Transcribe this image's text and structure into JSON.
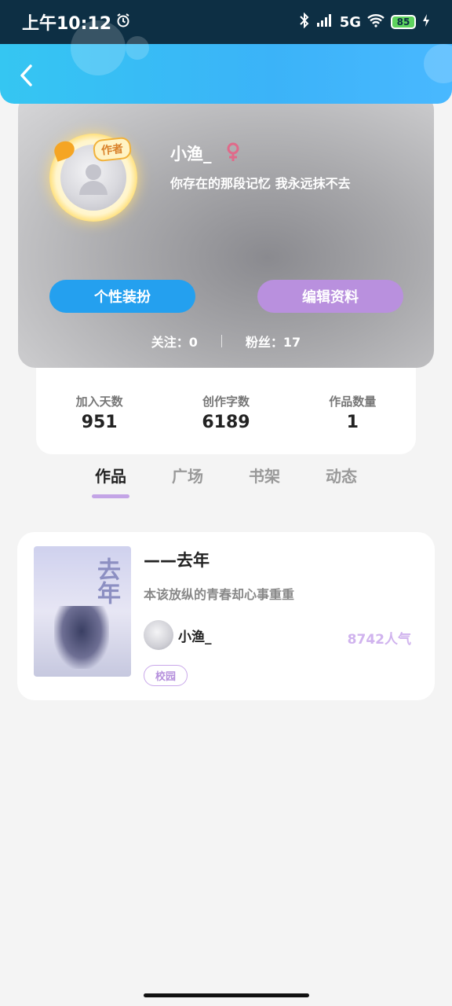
{
  "status_bar": {
    "time": "上午10:12",
    "network": "5G",
    "battery": "85"
  },
  "profile": {
    "author_badge": "作者",
    "username": "小渔_",
    "bio": "你存在的那段记忆 我永远抹不去",
    "gender_color": "#e06a8a",
    "buttons": {
      "dress_up": "个性装扮",
      "edit_profile": "编辑资料"
    },
    "follow_label": "关注：0",
    "fans_label": "粉丝：17"
  },
  "stats": [
    {
      "label": "加入天数",
      "value": "951"
    },
    {
      "label": "创作字数",
      "value": "6189"
    },
    {
      "label": "作品数量",
      "value": "1"
    }
  ],
  "tabs": [
    {
      "label": "作品",
      "active": true
    },
    {
      "label": "广场",
      "active": false
    },
    {
      "label": "书架",
      "active": false
    },
    {
      "label": "动态",
      "active": false
    }
  ],
  "works": [
    {
      "cover_text": "去年",
      "title": "——去年",
      "description": "本该放纵的青春却心事重重",
      "author": "小渔_",
      "popularity": "8742人气",
      "tag": "校园"
    }
  ],
  "colors": {
    "accent_blue": "#24a0ef",
    "accent_purple": "#b990de",
    "tab_underline": "#c3a4e6"
  }
}
